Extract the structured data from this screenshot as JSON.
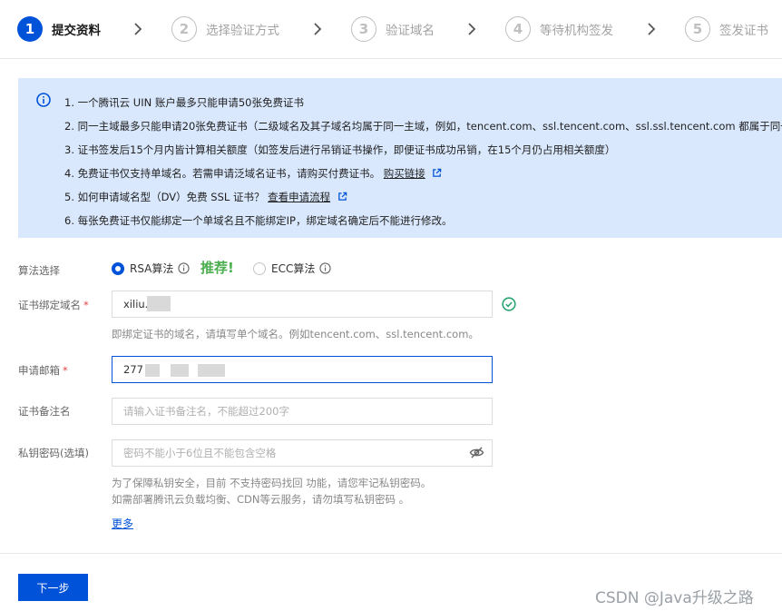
{
  "steps": [
    {
      "num": "1",
      "label": "提交资料"
    },
    {
      "num": "2",
      "label": "选择验证方式"
    },
    {
      "num": "3",
      "label": "验证域名"
    },
    {
      "num": "4",
      "label": "等待机构签发"
    },
    {
      "num": "5",
      "label": "签发证书"
    }
  ],
  "info": {
    "items": [
      "1. 一个腾讯云 UIN 账户最多只能申请50张免费证书",
      "2. 同一主域最多只能申请20张免费证书（二级域名及其子域名均属于同一主域，例如，tencent.com、ssl.tencent.com、ssl.ssl.tencent.com 都属于同一",
      "3. 证书签发后15个月内皆计算相关额度（如签发后进行吊销证书操作，即便证书成功吊销，在15个月仍占用相关额度）",
      "4. 免费证书仅支持单域名。若需申请泛域名证书，请购买付费证书。",
      "5. 如何申请域名型（DV）免费 SSL 证书？",
      "6. 每张免费证书仅能绑定一个单域名且不能绑定IP，绑定域名确定后不能进行修改。"
    ],
    "buy_link": "购买链接",
    "guide_link": "查看申请流程"
  },
  "form": {
    "algorithm_label": "算法选择",
    "rsa_label": "RSA算法",
    "recommend": "推荐!",
    "ecc_label": "ECC算法",
    "domain_label": "证书绑定域名",
    "domain_value": "xiliu.c",
    "domain_hint": "即绑定证书的域名，请填写单个域名。例如tencent.com、ssl.tencent.com。",
    "email_label": "申请邮箱",
    "email_value": "277",
    "alias_label": "证书备注名",
    "alias_placeholder": "请输入证书备注名，不能超过200字",
    "key_label": "私钥密码(选填)",
    "key_placeholder": "密码不能小于6位且不能包含空格",
    "key_hint_1": "为了保障私钥安全，目前 不支持密码找回 功能，请您牢记私钥密码。",
    "key_hint_2": "如需部署腾讯云负载均衡、CDN等云服务，请勿填写私钥密码 。",
    "more": "更多",
    "required_mark": "*"
  },
  "next_label": "下一步",
  "watermark": "CSDN @Java升级之路",
  "colors": {
    "primary": "#0052d9",
    "info_bg": "#d9e8fd",
    "success": "#2ba471",
    "recommend": "#4caf50"
  }
}
